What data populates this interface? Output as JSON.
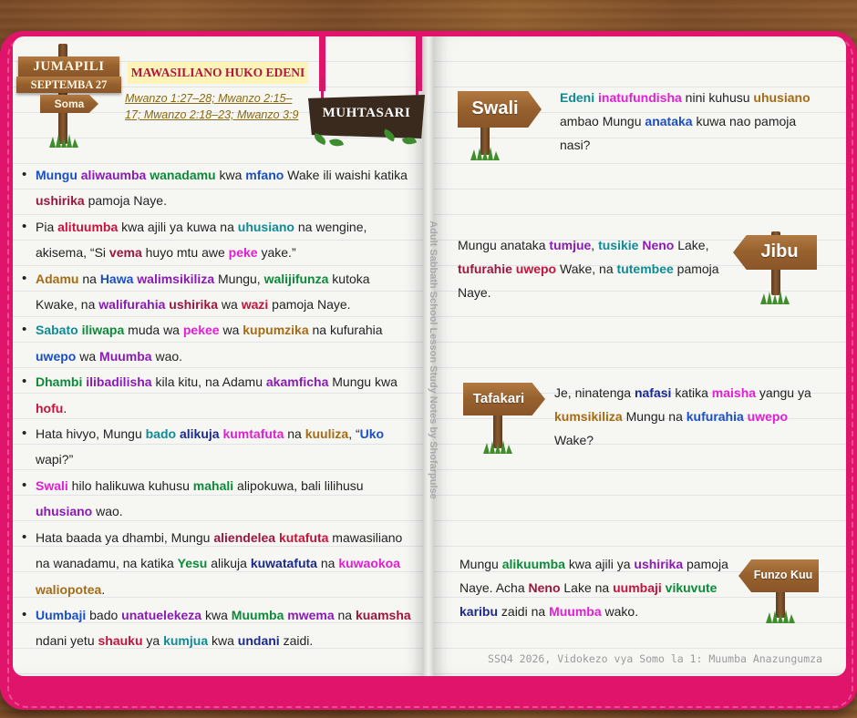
{
  "header": {
    "day": "JUMAPILI",
    "date": "SEPTEMBA 27",
    "sign_label": "Soma",
    "lesson_title": "MAWASILIANO HUKO EDENI",
    "references": "Mwanzo 1:27–28; Mwanzo 2:15–17; Mwanzo 2:18–23; Mwanzo 3:9",
    "summary_sign": "MUHTASARI"
  },
  "bullets": [
    [
      {
        "t": "Mungu",
        "c": "blue",
        "b": true
      },
      {
        "t": " "
      },
      {
        "t": "aliwaumba",
        "c": "purple",
        "b": true
      },
      {
        "t": " "
      },
      {
        "t": "wanadamu",
        "c": "green",
        "b": true
      },
      {
        "t": " kwa "
      },
      {
        "t": "mfano",
        "c": "blue",
        "b": true
      },
      {
        "t": " Wake ili waishi katika "
      },
      {
        "t": "ushirika",
        "c": "maroon",
        "b": true
      },
      {
        "t": " pamoja Naye."
      }
    ],
    [
      {
        "t": "Pia "
      },
      {
        "t": "alituumba",
        "c": "red",
        "b": true
      },
      {
        "t": " kwa ajili ya kuwa na "
      },
      {
        "t": "uhusiano",
        "c": "teal",
        "b": true
      },
      {
        "t": " na wengine, akisema, “Si "
      },
      {
        "t": "vema",
        "c": "maroon",
        "b": true
      },
      {
        "t": " huyo mtu awe "
      },
      {
        "t": "peke",
        "c": "magenta",
        "b": true
      },
      {
        "t": " yake.”"
      }
    ],
    [
      {
        "t": "Adamu",
        "c": "brown",
        "b": true
      },
      {
        "t": " na "
      },
      {
        "t": "Hawa",
        "c": "blue",
        "b": true
      },
      {
        "t": " "
      },
      {
        "t": "walimsikiliza",
        "c": "purple",
        "b": true
      },
      {
        "t": " Mungu, "
      },
      {
        "t": "walijifunza",
        "c": "green",
        "b": true
      },
      {
        "t": " kutoka Kwake, na "
      },
      {
        "t": "walifurahia",
        "c": "purple",
        "b": true
      },
      {
        "t": " "
      },
      {
        "t": "ushirika",
        "c": "maroon",
        "b": true
      },
      {
        "t": " wa "
      },
      {
        "t": "wazi",
        "c": "red",
        "b": true
      },
      {
        "t": " pamoja Naye."
      }
    ],
    [
      {
        "t": "Sabato",
        "c": "teal",
        "b": true
      },
      {
        "t": " "
      },
      {
        "t": "iliwapa",
        "c": "green",
        "b": true
      },
      {
        "t": " muda wa "
      },
      {
        "t": "pekee",
        "c": "magenta",
        "b": true
      },
      {
        "t": " wa "
      },
      {
        "t": "kupumzika",
        "c": "brown",
        "b": true
      },
      {
        "t": " na kufurahia "
      },
      {
        "t": "uwepo",
        "c": "blue",
        "b": true
      },
      {
        "t": " wa "
      },
      {
        "t": "Muumba",
        "c": "purple",
        "b": true
      },
      {
        "t": " wao."
      }
    ],
    [
      {
        "t": "Dhambi",
        "c": "green",
        "b": true
      },
      {
        "t": " "
      },
      {
        "t": "ilibadilisha",
        "c": "purple",
        "b": true
      },
      {
        "t": " kila kitu, na Adamu "
      },
      {
        "t": "akamficha",
        "c": "purple",
        "b": true
      },
      {
        "t": " Mungu kwa "
      },
      {
        "t": "hofu",
        "c": "red",
        "b": true
      },
      {
        "t": "."
      }
    ],
    [
      {
        "t": "Hata hivyo, Mungu "
      },
      {
        "t": "bado",
        "c": "teal",
        "b": true
      },
      {
        "t": " "
      },
      {
        "t": "alikuja",
        "c": "navy",
        "b": true
      },
      {
        "t": " "
      },
      {
        "t": "kumtafuta",
        "c": "magenta",
        "b": true
      },
      {
        "t": " na "
      },
      {
        "t": "kuuliza",
        "c": "brown",
        "b": true
      },
      {
        "t": ", “"
      },
      {
        "t": "Uko",
        "c": "blue",
        "b": true
      },
      {
        "t": " wapi?”"
      }
    ],
    [
      {
        "t": "Swali",
        "c": "magenta",
        "b": true
      },
      {
        "t": " hilo halikuwa kuhusu "
      },
      {
        "t": "mahali",
        "c": "green",
        "b": true
      },
      {
        "t": " alipokuwa, bali lilihusu "
      },
      {
        "t": "uhusiano",
        "c": "purple",
        "b": true
      },
      {
        "t": " wao."
      }
    ],
    [
      {
        "t": "Hata baada ya dhambi, Mungu "
      },
      {
        "t": "aliendelea",
        "c": "maroon",
        "b": true
      },
      {
        "t": " "
      },
      {
        "t": "kutafuta",
        "c": "red",
        "b": true
      },
      {
        "t": " mawasiliano na wanadamu, na katika "
      },
      {
        "t": "Yesu",
        "c": "green",
        "b": true
      },
      {
        "t": " alikuja "
      },
      {
        "t": "kuwatafuta",
        "c": "navy",
        "b": true
      },
      {
        "t": " na "
      },
      {
        "t": "kuwaokoa",
        "c": "magenta",
        "b": true
      },
      {
        "t": " "
      },
      {
        "t": "waliopotea",
        "c": "brown",
        "b": true
      },
      {
        "t": "."
      }
    ],
    [
      {
        "t": "Uumbaji",
        "c": "blue",
        "b": true
      },
      {
        "t": " bado "
      },
      {
        "t": "unatuelekeza",
        "c": "purple",
        "b": true
      },
      {
        "t": " kwa "
      },
      {
        "t": "Muumba",
        "c": "green",
        "b": true
      },
      {
        "t": " "
      },
      {
        "t": "mwema",
        "c": "purple",
        "b": true
      },
      {
        "t": " na "
      },
      {
        "t": "kuamsha",
        "c": "maroon",
        "b": true
      },
      {
        "t": " ndani yetu "
      },
      {
        "t": "shauku",
        "c": "red",
        "b": true
      },
      {
        "t": " ya "
      },
      {
        "t": "kumjua",
        "c": "teal",
        "b": true
      },
      {
        "t": " kwa "
      },
      {
        "t": "undani",
        "c": "navy",
        "b": true
      },
      {
        "t": " zaidi."
      }
    ]
  ],
  "vertical_note": "Adult Sabbath School Lesson Study Notes by Shofarpulse",
  "sections": {
    "swali": {
      "label": "Swali",
      "runs": [
        {
          "t": "Edeni",
          "c": "teal",
          "b": true
        },
        {
          "t": " "
        },
        {
          "t": "inatufundisha",
          "c": "magenta",
          "b": true
        },
        {
          "t": " nini kuhusu "
        },
        {
          "t": "uhusiano",
          "c": "brown",
          "b": true
        },
        {
          "t": " ambao Mungu "
        },
        {
          "t": "anataka",
          "c": "blue",
          "b": true
        },
        {
          "t": " kuwa nao pamoja nasi?"
        }
      ]
    },
    "jibu": {
      "label": "Jibu",
      "runs": [
        {
          "t": "Mungu anataka "
        },
        {
          "t": "tumjue",
          "c": "purple",
          "b": true
        },
        {
          "t": ", "
        },
        {
          "t": "tusikie",
          "c": "teal",
          "b": true
        },
        {
          "t": " "
        },
        {
          "t": "Neno",
          "c": "purple",
          "b": true
        },
        {
          "t": " Lake, "
        },
        {
          "t": "tufurahie",
          "c": "maroon",
          "b": true
        },
        {
          "t": " "
        },
        {
          "t": "uwepo",
          "c": "red",
          "b": true
        },
        {
          "t": " Wake, na "
        },
        {
          "t": "tutembee",
          "c": "teal",
          "b": true
        },
        {
          "t": " pamoja Naye."
        }
      ]
    },
    "tafakari": {
      "label": "Tafakari",
      "runs": [
        {
          "t": "Je, ninatenga "
        },
        {
          "t": "nafasi",
          "c": "navy",
          "b": true
        },
        {
          "t": " katika "
        },
        {
          "t": "maisha",
          "c": "magenta",
          "b": true
        },
        {
          "t": " yangu ya "
        },
        {
          "t": "kumsikiliza",
          "c": "brown",
          "b": true
        },
        {
          "t": " Mungu na "
        },
        {
          "t": "kufurahia",
          "c": "blue",
          "b": true
        },
        {
          "t": " "
        },
        {
          "t": "uwepo",
          "c": "magenta",
          "b": true
        },
        {
          "t": " Wake?"
        }
      ]
    },
    "funzo": {
      "label": "Funzo Kuu",
      "runs": [
        {
          "t": "Mungu "
        },
        {
          "t": "alikuumba",
          "c": "green",
          "b": true
        },
        {
          "t": " kwa ajili ya "
        },
        {
          "t": "ushirika",
          "c": "purple",
          "b": true
        },
        {
          "t": " pamoja Naye. Acha "
        },
        {
          "t": "Neno",
          "c": "maroon",
          "b": true
        },
        {
          "t": " Lake na "
        },
        {
          "t": "uumbaji",
          "c": "red",
          "b": true
        },
        {
          "t": " "
        },
        {
          "t": "vikuvute",
          "c": "green",
          "b": true
        },
        {
          "t": " "
        },
        {
          "t": "karibu",
          "c": "navy",
          "b": true
        },
        {
          "t": " zaidi na "
        },
        {
          "t": "Muumba",
          "c": "magenta",
          "b": true
        },
        {
          "t": " wako."
        }
      ]
    }
  },
  "footer": "SSQ4 2026, Vidokezo vya Somo la 1: Muumba Anazungumza",
  "colors": {
    "cover": "#e0146b",
    "page": "#f6f6f3",
    "wood": "#98622f"
  }
}
